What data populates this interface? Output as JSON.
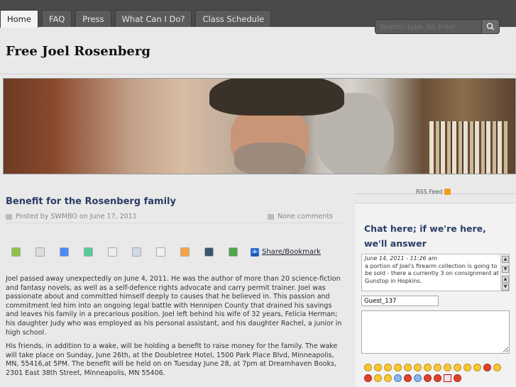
{
  "nav": {
    "tabs": [
      "Home",
      "FAQ",
      "Press",
      "What Can I Do?",
      "Class Schedule"
    ],
    "active_index": 0
  },
  "search": {
    "placeholder": "Search: type, hit enter",
    "button_icon": "search-icon"
  },
  "site": {
    "title": "Free Joel Rosenberg"
  },
  "post": {
    "title": "Benefit for the Rosenberg family",
    "meta": "Posted by SWMBO on June 17, 2011",
    "comments": "None comments",
    "share_icons": [
      "evernote-icon",
      "folder-icon",
      "google-icon",
      "messenger-icon",
      "instapaper-icon",
      "clip-icon",
      "reddit-icon",
      "blogger-icon",
      "tumblr-icon",
      "stumbleupon-icon"
    ],
    "share_label": "Share/Bookmark",
    "paragraphs": [
      "Joel passed away unexpectedly on June 4, 2011. He was the author of more than 20 science-fiction and fantasy novels, as well as a self-defence rights advocate and carry permit trainer. Joel was passionate about and committed himself deeply to causes that he believed in. This passion and commitment led him into an ongoing legal battle with Hennipen County that drained his savings and leaves his family in a precarious position. Joel left behind his wife of 32 years, Felicia Herman; his daughter Judy who was employed as his personal assistant, and his daughter Rachel, a junior in high school.",
      "His friends, in addition to a wake, will be holding a benefit to raise money for the family. The wake will take place on Sunday, June 26th, at the Doubletree Hotel, 1500 Park Place Blvd, Minneapolis, MN, 55416,at 5PM. The benefit will be held on on Tuesday June 28, at 7pm at Dreamhaven Books, 2301 East 38th Street, Minneapolis, MN 55406."
    ]
  },
  "sidebar": {
    "rss_label": "RSS Feed",
    "chat_title": "Chat here; if we're here, we'll answer",
    "chat_entry": {
      "date": "June 14, 2011 - 11:26 am",
      "text": "a portion of Joel's firearm collection is going to be sold - there a currently 3 on consignment at Gunstop in Hopkins."
    },
    "name_value": "Guest_137",
    "smiley_count": 24
  }
}
